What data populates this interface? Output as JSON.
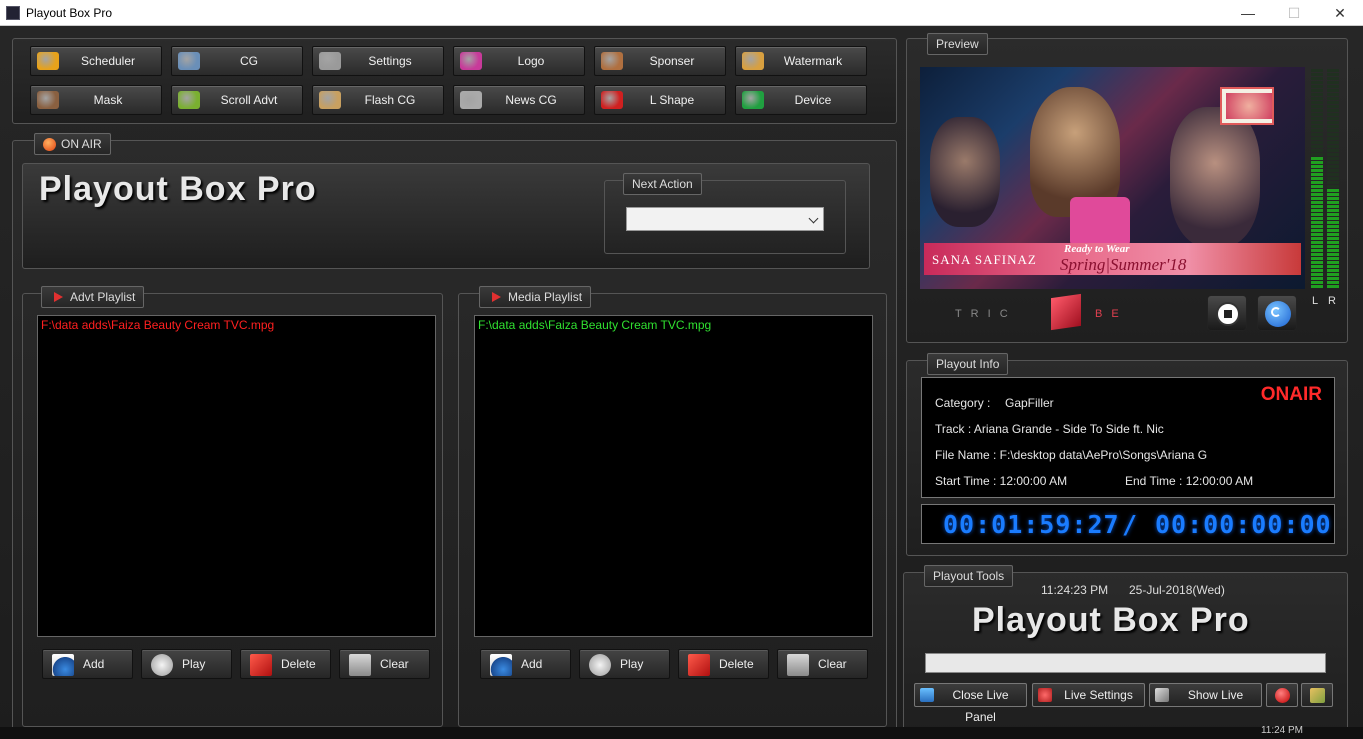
{
  "window": {
    "title": "Playout Box Pro",
    "minimize": "—",
    "maximize": "☐",
    "close": "✕"
  },
  "toolbar": {
    "row1": [
      {
        "label": "Scheduler",
        "icon": "calendar-icon",
        "color": "#e8a21a"
      },
      {
        "label": "CG",
        "icon": "eye-icon",
        "color": "#6a8fb8"
      },
      {
        "label": "Settings",
        "icon": "gear-icon",
        "color": "#9a9a9a"
      },
      {
        "label": "Logo",
        "icon": "logo-icon",
        "color": "#c83a9a"
      },
      {
        "label": "Sponser",
        "icon": "person-icon",
        "color": "#b07040"
      },
      {
        "label": "Watermark",
        "icon": "watermark-icon",
        "color": "#d8a040"
      }
    ],
    "row2": [
      {
        "label": "Mask",
        "icon": "mask-icon",
        "color": "#8a6040"
      },
      {
        "label": "Scroll Advt",
        "icon": "scroll-icon",
        "color": "#7ab030"
      },
      {
        "label": "Flash CG",
        "icon": "flash-icon",
        "color": "#c8a060"
      },
      {
        "label": "News CG",
        "icon": "news-icon",
        "color": "#aaaaaa"
      },
      {
        "label": "L Shape",
        "icon": "lshape-icon",
        "color": "#d02020"
      },
      {
        "label": "Device",
        "icon": "device-icon",
        "color": "#20a040"
      }
    ]
  },
  "onair": {
    "label": "ON AIR",
    "title": "Playout Box Pro",
    "next_action_label": "Next Action",
    "next_action_value": ""
  },
  "advt_playlist": {
    "label": "Advt Playlist",
    "items": [
      "F:\\data adds\\Faiza Beauty Cream TVC.mpg"
    ],
    "item_color": "#ff2020",
    "buttons": {
      "add": "Add",
      "play": "Play",
      "delete": "Delete",
      "clear": "Clear"
    }
  },
  "media_playlist": {
    "label": "Media Playlist",
    "items": [
      "F:\\data adds\\Faiza Beauty Cream TVC.mpg"
    ],
    "item_color": "#30e030",
    "buttons": {
      "add": "Add",
      "play": "Play",
      "delete": "Delete",
      "clear": "Clear"
    }
  },
  "preview": {
    "label": "Preview",
    "overlay_brand": "SANA SAFINAZ",
    "overlay_tagline_1": "Ready to Wear",
    "overlay_tagline_2": "Spring|Summer'18",
    "logo_text_left": "T R I C",
    "logo_text_right": "B E",
    "meter_left_label": "L",
    "meter_right_label": "R",
    "meter_left_level": 0.6,
    "meter_right_level": 0.45
  },
  "playout_info": {
    "label": "Playout Info",
    "status": "ONAIR",
    "status_color": "#ff2a2a",
    "category_label": "Category :",
    "category_value": "GapFiller",
    "track": "Track : Ariana Grande - Side To Side ft. Nic",
    "file_name": "File Name : F:\\desktop data\\AePro\\Songs\\Ariana G",
    "start_time": "Start Time : 12:00:00 AM",
    "end_time": "End Time : 12:00:00 AM",
    "elapsed": "00:01:59:27",
    "separator": "/",
    "remaining": "00:00:00:00"
  },
  "playout_tools": {
    "label": "Playout Tools",
    "clock": "11:24:23 PM",
    "date": "25-Jul-2018(Wed)",
    "title": "Playout Box Pro",
    "buttons": {
      "close_live": "Close Live Panel",
      "live_settings": "Live Settings",
      "show_live": "Show Live"
    }
  },
  "taskbar": {
    "time": "11:24 PM"
  }
}
